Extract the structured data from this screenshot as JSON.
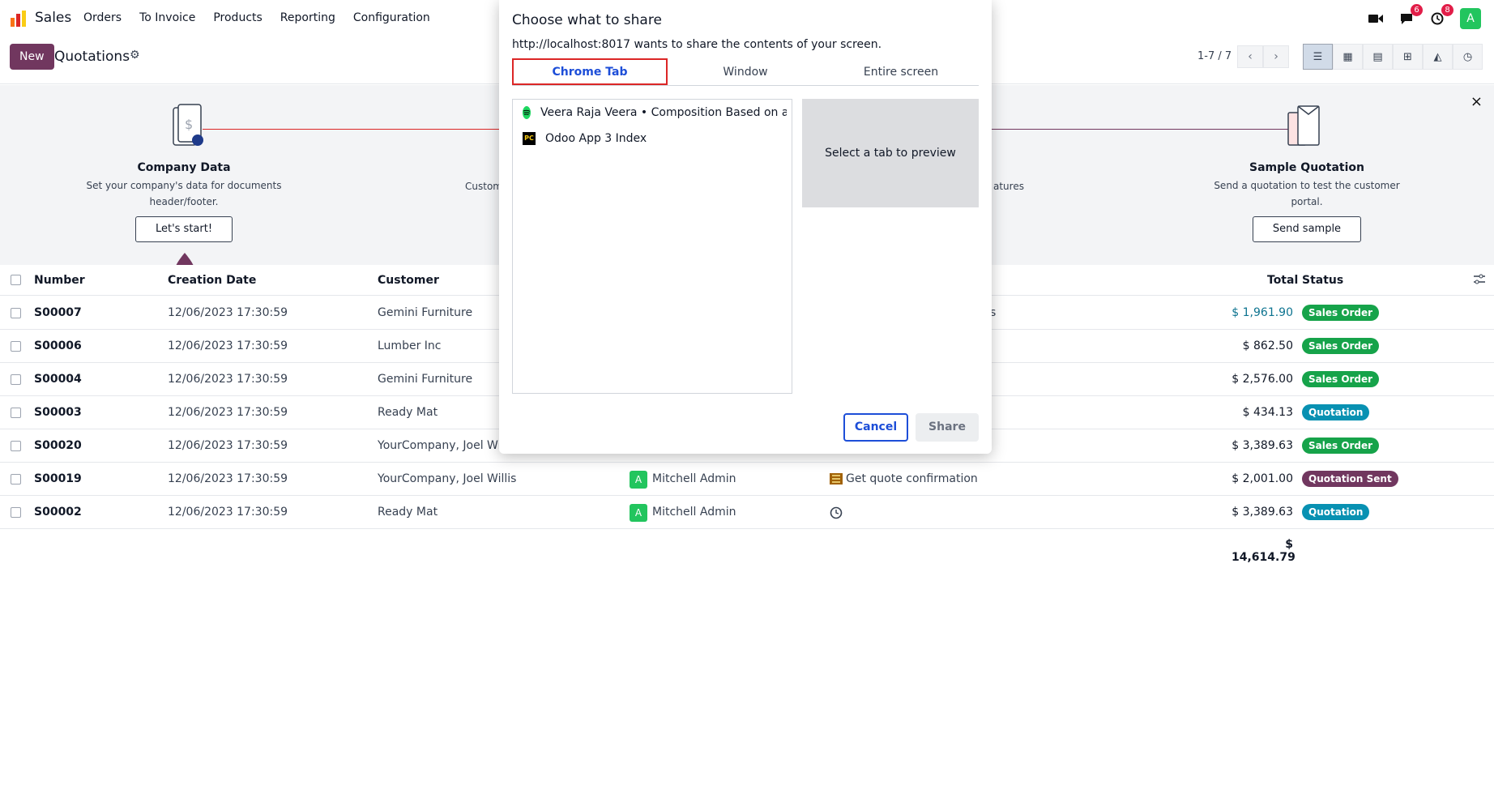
{
  "navbar": {
    "app_name": "Sales",
    "menu": [
      "Orders",
      "To Invoice",
      "Products",
      "Reporting",
      "Configuration"
    ],
    "badges": {
      "messages": "6",
      "activities": "8"
    },
    "avatar_letter": "A"
  },
  "control": {
    "new_label": "New",
    "title": "Quotations",
    "pager": "1-7 / 7"
  },
  "onboarding": {
    "step1": {
      "title": "Company Data",
      "desc_line1": "Set your company's data for documents",
      "desc_line2": "header/footer.",
      "button": "Let's start!"
    },
    "step2_partial": "Custom",
    "step3_partial": "atures",
    "step4": {
      "title": "Sample Quotation",
      "desc_line1": "Send a quotation to test the customer",
      "desc_line2": "portal.",
      "button": "Send sample"
    },
    "close": "×"
  },
  "table": {
    "headers": {
      "number": "Number",
      "date": "Creation Date",
      "customer": "Customer",
      "total": "Total",
      "status": "Status"
    },
    "rows": [
      {
        "number": "S00007",
        "date": "12/06/2023 17:30:59",
        "customer": "Gemini Furniture",
        "total": "$ 1,961.90",
        "status": "Sales Order",
        "partial_right": "s"
      },
      {
        "number": "S00006",
        "date": "12/06/2023 17:30:59",
        "customer": "Lumber Inc",
        "total": "$ 862.50",
        "status": "Sales Order"
      },
      {
        "number": "S00004",
        "date": "12/06/2023 17:30:59",
        "customer": "Gemini Furniture",
        "total": "$ 2,576.00",
        "status": "Sales Order"
      },
      {
        "number": "S00003",
        "date": "12/06/2023 17:30:59",
        "customer": "Ready Mat",
        "total": "$ 434.13",
        "status": "Quotation"
      },
      {
        "number": "S00020",
        "date": "12/06/2023 17:30:59",
        "customer": "YourCompany, Joel Will",
        "total": "$ 3,389.63",
        "status": "Sales Order"
      },
      {
        "number": "S00019",
        "date": "12/06/2023 17:30:59",
        "customer": "YourCompany, Joel Willis",
        "salesperson": "Mitchell Admin",
        "activity": "Get quote confirmation",
        "total": "$ 2,001.00",
        "status": "Quotation Sent"
      },
      {
        "number": "S00002",
        "date": "12/06/2023 17:30:59",
        "customer": "Ready Mat",
        "salesperson": "Mitchell Admin",
        "total": "$ 3,389.63",
        "status": "Quotation"
      }
    ],
    "grand_total": "$ 14,614.79"
  },
  "share_dialog": {
    "title": "Choose what to share",
    "subtitle": "http://localhost:8017 wants to share the contents of your screen.",
    "tabs": [
      "Chrome Tab",
      "Window",
      "Entire screen"
    ],
    "tab_items": [
      "Veera Raja Veera • Composition Based on a",
      "Odoo App 3 Index"
    ],
    "preview_text": "Select a tab to preview",
    "cancel": "Cancel",
    "share": "Share"
  },
  "colors": {
    "brand": "#71375f",
    "success": "#16a34a",
    "info": "#0891b2",
    "dialog_accent": "#1d4ed8"
  }
}
